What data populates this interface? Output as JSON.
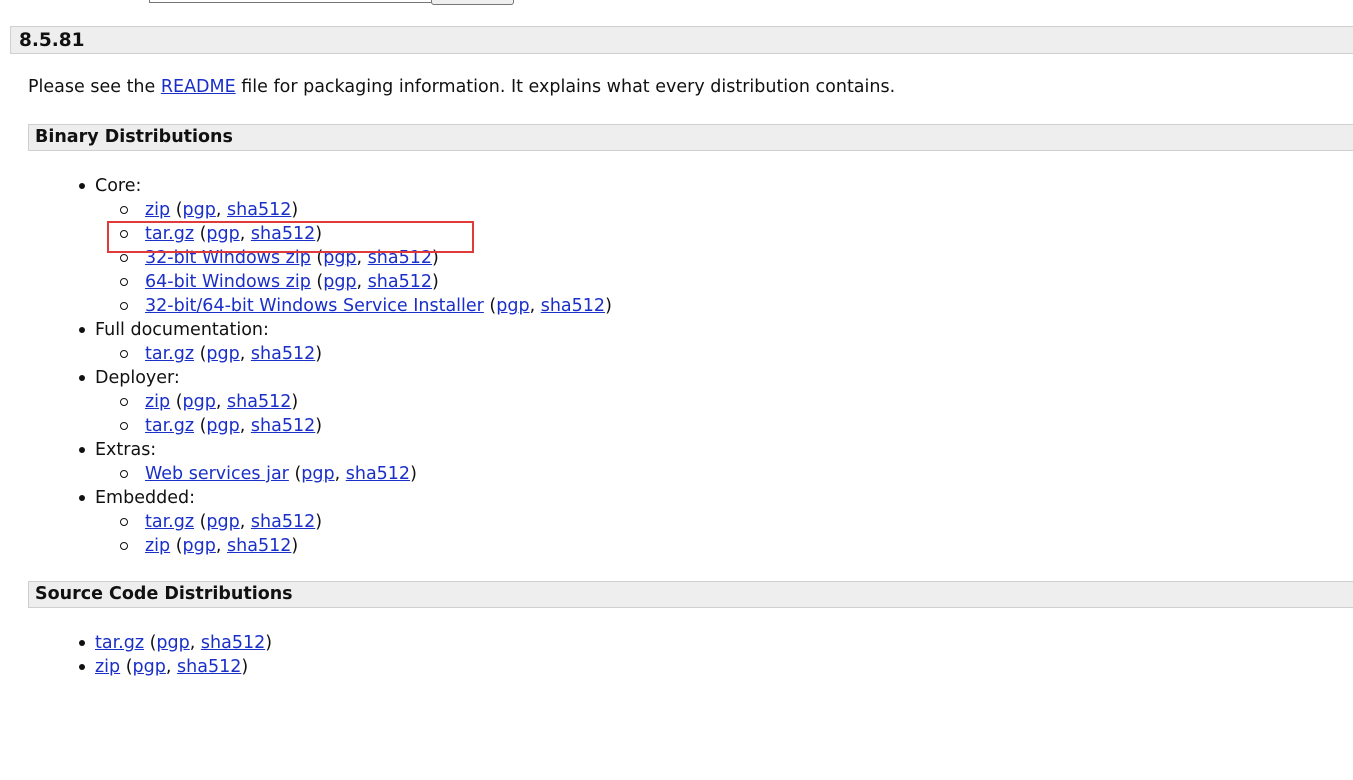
{
  "version": "8.5.81",
  "intro": {
    "before": "Please see the ",
    "link": "README",
    "after": " file for packaging information. It explains what every distribution contains."
  },
  "binary": {
    "heading": "Binary Distributions",
    "core": {
      "label": "Core:",
      "items": [
        {
          "name": "zip",
          "pgp": "pgp",
          "sha": "sha512"
        },
        {
          "name": "tar.gz",
          "pgp": "pgp",
          "sha": "sha512"
        },
        {
          "name": "32-bit Windows zip",
          "pgp": "pgp",
          "sha": "sha512"
        },
        {
          "name": "64-bit Windows zip",
          "pgp": "pgp",
          "sha": "sha512"
        },
        {
          "name": "32-bit/64-bit Windows Service Installer",
          "pgp": "pgp",
          "sha": "sha512"
        }
      ]
    },
    "docs": {
      "label": "Full documentation:",
      "items": [
        {
          "name": "tar.gz",
          "pgp": "pgp",
          "sha": "sha512"
        }
      ]
    },
    "deployer": {
      "label": "Deployer:",
      "items": [
        {
          "name": "zip",
          "pgp": "pgp",
          "sha": "sha512"
        },
        {
          "name": "tar.gz",
          "pgp": "pgp",
          "sha": "sha512"
        }
      ]
    },
    "extras": {
      "label": "Extras:",
      "items": [
        {
          "name": "Web services jar",
          "pgp": "pgp",
          "sha": "sha512"
        }
      ]
    },
    "embedded": {
      "label": "Embedded:",
      "items": [
        {
          "name": "tar.gz",
          "pgp": "pgp",
          "sha": "sha512"
        },
        {
          "name": "zip",
          "pgp": "pgp",
          "sha": "sha512"
        }
      ]
    }
  },
  "source": {
    "heading": "Source Code Distributions",
    "items": [
      {
        "name": "tar.gz",
        "pgp": "pgp",
        "sha": "sha512"
      },
      {
        "name": "zip",
        "pgp": "pgp",
        "sha": "sha512"
      }
    ]
  },
  "colors": {
    "link": "#1a2fc8",
    "highlight": "#e03a3a",
    "bar_bg": "#eeeeee"
  }
}
